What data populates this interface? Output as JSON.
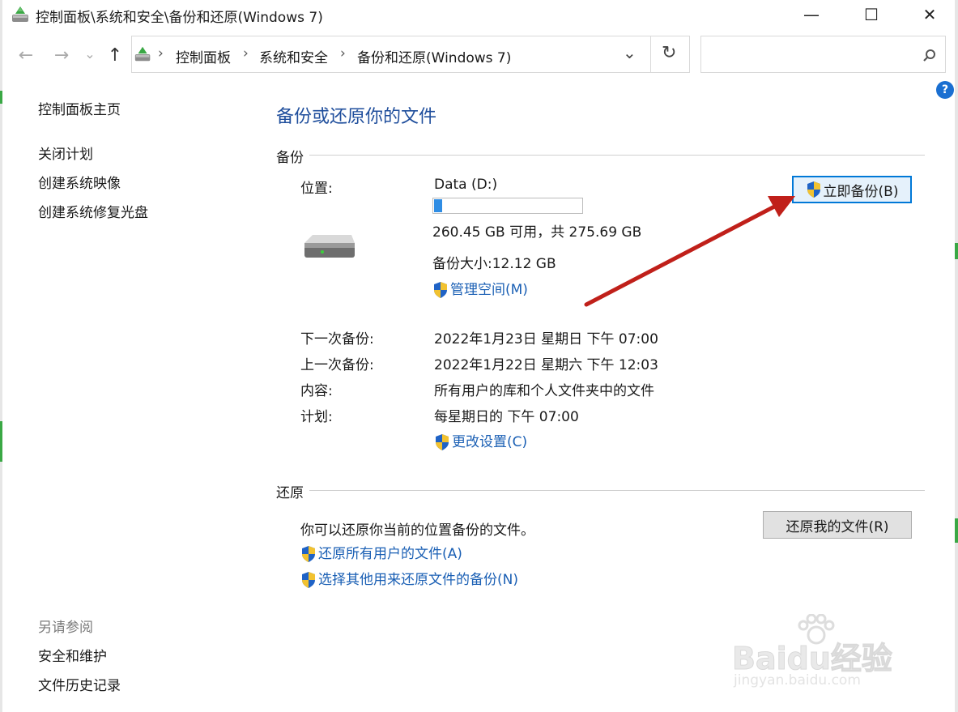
{
  "window": {
    "title": "控制面板\\系统和安全\\备份和还原(Windows 7)",
    "minimize": "—",
    "maximize": "☐",
    "close": "✕"
  },
  "nav": {
    "back": "←",
    "forward": "→",
    "recent": "⌄",
    "up": "↑",
    "breadcrumb": [
      "控制面板",
      "系统和安全",
      "备份和还原(Windows 7)"
    ],
    "sep": "›",
    "dropdown": "⌄",
    "refresh": "↻",
    "search_placeholder": "",
    "help": "?"
  },
  "sidebar": {
    "home": "控制面板主页",
    "links": [
      "关闭计划",
      "创建系统映像",
      "创建系统修复光盘"
    ],
    "see_also_title": "另请参阅",
    "see_also": [
      "安全和维护",
      "文件历史记录"
    ]
  },
  "main": {
    "title": "备份或还原你的文件",
    "backup": {
      "heading": "备份",
      "location_label": "位置:",
      "drive_name": "Data (D:)",
      "drive_used_fraction": 0.055,
      "space": "260.45 GB 可用，共 275.69 GB",
      "backup_size": "备份大小:12.12 GB",
      "manage_space": "管理空间(M)",
      "backup_now": "立即备份(B)",
      "rows": [
        {
          "label": "下一次备份:",
          "value": "2022年1月23日 星期日 下午 07:00"
        },
        {
          "label": "上一次备份:",
          "value": "2022年1月22日 星期六 下午 12:03"
        },
        {
          "label": "内容:",
          "value": "所有用户的库和个人文件夹中的文件"
        },
        {
          "label": "计划:",
          "value": "每星期日的 下午 07:00"
        }
      ],
      "change_settings": "更改设置(C)"
    },
    "restore": {
      "heading": "还原",
      "description": "你可以还原你当前的位置备份的文件。",
      "restore_my_files": "还原我的文件(R)",
      "restore_all_users": "还原所有用户的文件(A)",
      "select_other_backup": "选择其他用来还原文件的备份(N)"
    }
  },
  "watermark": {
    "brand": "Baidu经验",
    "url": "jingyan.baidu.com"
  },
  "colors": {
    "link": "#1a5fb4",
    "title": "#1f4e9c",
    "annotation_arrow": "#c0201a",
    "progress": "#2f8de4"
  }
}
